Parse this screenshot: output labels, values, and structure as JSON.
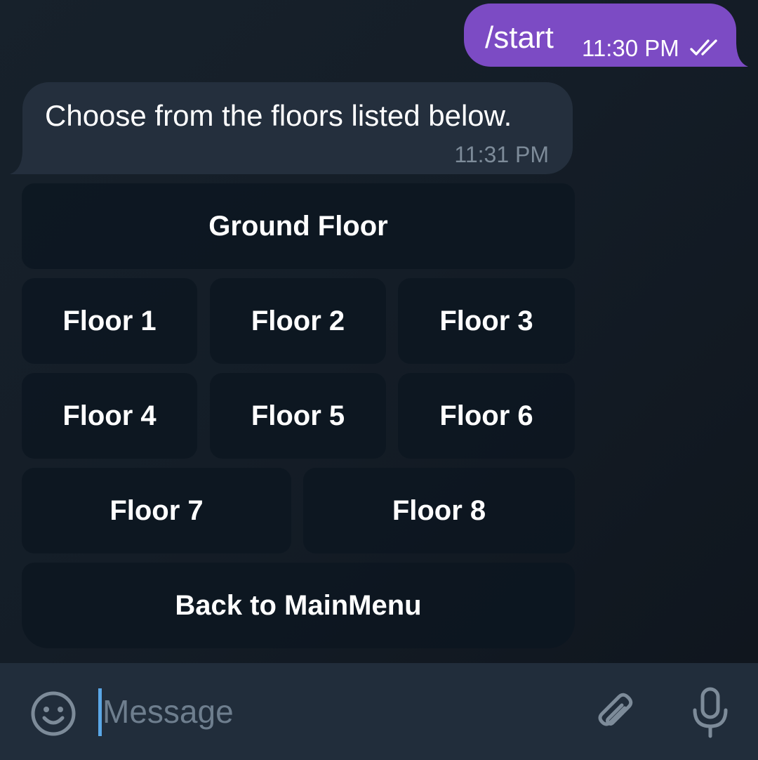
{
  "messages": {
    "outgoing": {
      "text": "/start",
      "time": "11:30 PM",
      "status_icon": "double-check-icon"
    },
    "incoming": {
      "text": "Choose from the floors listed below.",
      "time": "11:31 PM"
    }
  },
  "keyboard": {
    "ground_floor": "Ground Floor",
    "floor_1": "Floor 1",
    "floor_2": "Floor 2",
    "floor_3": "Floor 3",
    "floor_4": "Floor 4",
    "floor_5": "Floor 5",
    "floor_6": "Floor 6",
    "floor_7": "Floor 7",
    "floor_8": "Floor 8",
    "back": "Back to MainMenu"
  },
  "composer": {
    "placeholder": "Message",
    "value": "",
    "icons": [
      "emoji-icon",
      "paperclip-icon",
      "microphone-icon"
    ]
  },
  "colors": {
    "outgoing_bubble": "#7c4bc4",
    "incoming_bubble": "#242f3d",
    "composer_bg": "#212d3b",
    "cursor": "#5aa7e6",
    "muted_text": "#7d8b99"
  }
}
